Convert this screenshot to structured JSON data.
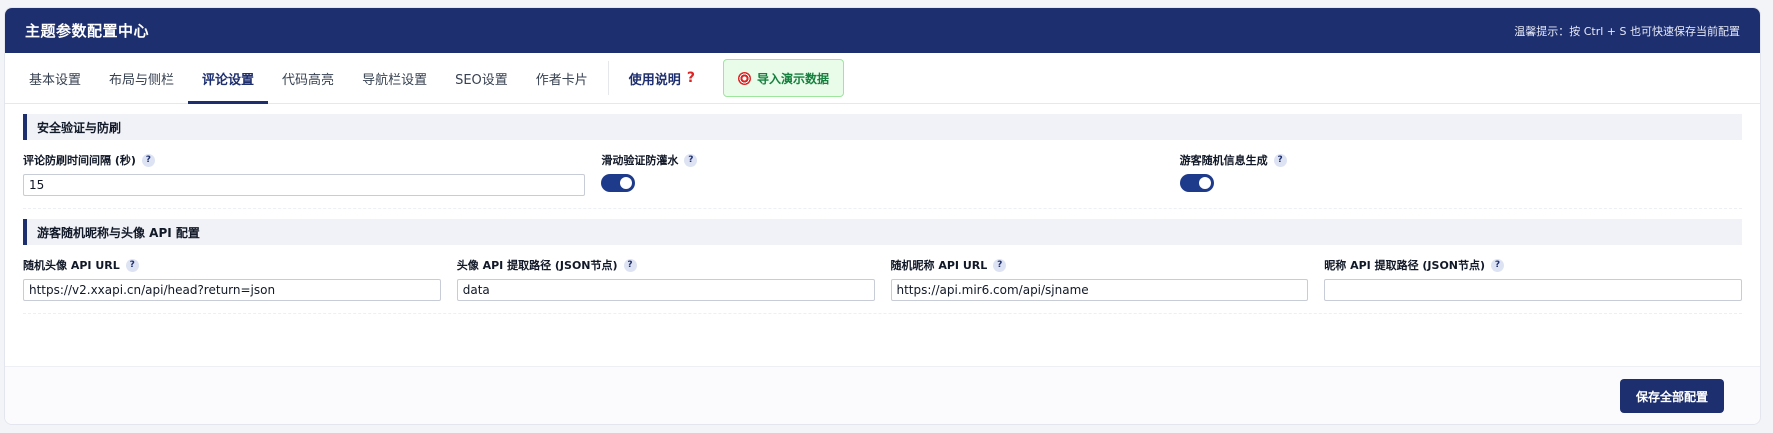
{
  "header": {
    "title": "主题参数配置中心",
    "tip": "温馨提示：按 Ctrl + S 也可快速保存当前配置"
  },
  "tabs": [
    {
      "label": "基本设置",
      "active": false
    },
    {
      "label": "布局与侧栏",
      "active": false
    },
    {
      "label": "评论设置",
      "active": true
    },
    {
      "label": "代码高亮",
      "active": false
    },
    {
      "label": "导航栏设置",
      "active": false
    },
    {
      "label": "SEO设置",
      "active": false
    },
    {
      "label": "作者卡片",
      "active": false
    }
  ],
  "help": {
    "label": "使用说明",
    "mark": "?"
  },
  "demo_button": {
    "label": "导入演示数据",
    "icon": "dart-icon"
  },
  "section1": {
    "title": "安全验证与防刷",
    "fields": {
      "interval": {
        "label": "评论防刷时间间隔 (秒)",
        "value": "15"
      },
      "slider_verify": {
        "label": "滑动验证防灌水",
        "on": true
      },
      "guest_random": {
        "label": "游客随机信息生成",
        "on": true
      }
    }
  },
  "section2": {
    "title": "游客随机昵称与头像 API 配置",
    "fields": {
      "avatar_api_url": {
        "label": "随机头像 API URL",
        "value": "https://v2.xxapi.cn/api/head?return=json"
      },
      "avatar_json_path": {
        "label": "头像 API 提取路径 (JSON节点)",
        "value": "data"
      },
      "nickname_api_url": {
        "label": "随机昵称 API URL",
        "value": "https://api.mir6.com/api/sjname"
      },
      "nickname_json_path": {
        "label": "昵称 API 提取路径 (JSON节点)",
        "value": ""
      }
    }
  },
  "help_icon_glyph": "?",
  "footer": {
    "save_label": "保存全部配置"
  },
  "colors": {
    "primary": "#1e2f6f",
    "accent_green": "#15803d",
    "help_red": "#dc2626"
  }
}
